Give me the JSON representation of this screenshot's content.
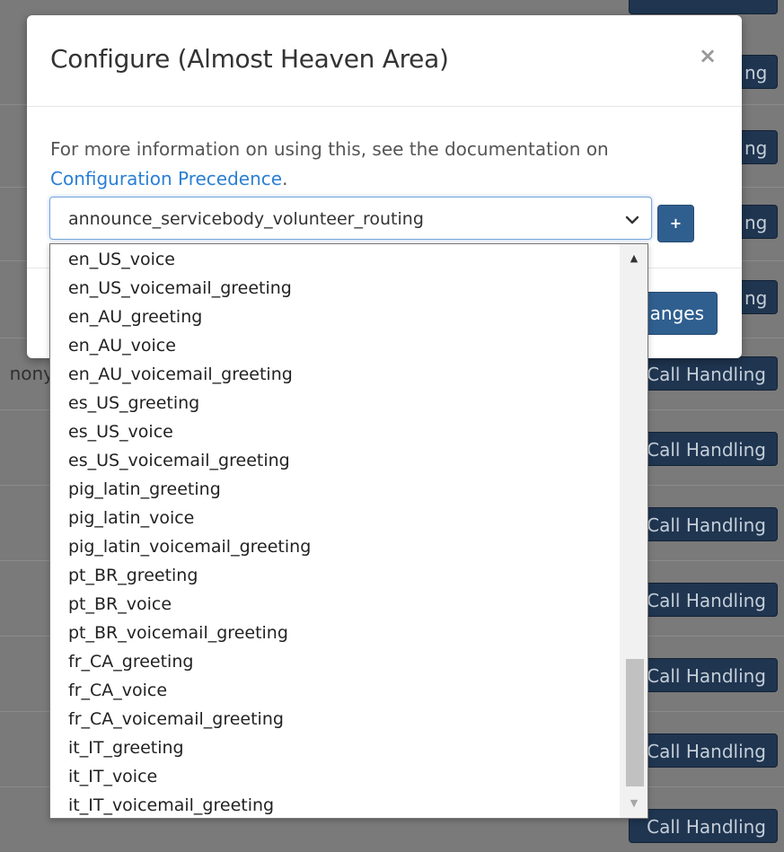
{
  "background": {
    "button_full_label": "Call Handling",
    "partial_texts": {
      "row_top_1": "ng",
      "row_top_2": "ng",
      "row_top_3": "ng",
      "row_top_4": "ng",
      "left_text": "nony"
    }
  },
  "modal": {
    "title": "Configure (Almost Heaven Area)",
    "close_label": "×",
    "description_prefix": "For more information on using this, see the documentation on ",
    "link_text": "Configuration Precedence",
    "description_suffix": ".",
    "plus_label": "+",
    "save_label_visible": "anges"
  },
  "select": {
    "selected_value": "announce_servicebody_volunteer_routing",
    "chevron_icon": "chevron-down-icon"
  },
  "dropdown": {
    "options": [
      "en_US_voice",
      "en_US_voicemail_greeting",
      "en_AU_greeting",
      "en_AU_voice",
      "en_AU_voicemail_greeting",
      "es_US_greeting",
      "es_US_voice",
      "es_US_voicemail_greeting",
      "pig_latin_greeting",
      "pig_latin_voice",
      "pig_latin_voicemail_greeting",
      "pt_BR_greeting",
      "pt_BR_voice",
      "pt_BR_voicemail_greeting",
      "fr_CA_greeting",
      "fr_CA_voice",
      "fr_CA_voicemail_greeting",
      "it_IT_greeting",
      "it_IT_voice",
      "it_IT_voicemail_greeting"
    ]
  },
  "colors": {
    "primary_button": "#2f5f8f",
    "background_button": "#1f3550",
    "link": "#2a7fd4"
  }
}
